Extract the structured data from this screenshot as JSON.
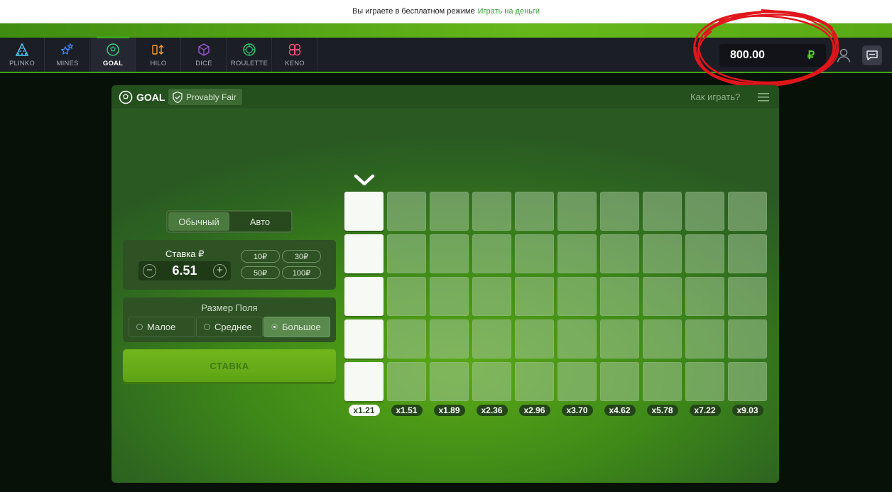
{
  "notice": {
    "text": "Вы играете в бесплатном режиме",
    "link": "Играть на деньги"
  },
  "nav": {
    "items": [
      {
        "label": "PLINKO",
        "icon": "plinko-icon",
        "color": "#4fd0ff"
      },
      {
        "label": "MINES",
        "icon": "mines-icon",
        "color": "#3f8cff"
      },
      {
        "label": "GOAL",
        "icon": "goal-icon",
        "color": "#39d07a",
        "active": true
      },
      {
        "label": "HILO",
        "icon": "hilo-icon",
        "color": "#ff9a2e"
      },
      {
        "label": "DICE",
        "icon": "dice-icon",
        "color": "#9b5bd6"
      },
      {
        "label": "ROULETTE",
        "icon": "roulette-icon",
        "color": "#2ec46e"
      },
      {
        "label": "KENO",
        "icon": "keno-icon",
        "color": "#ff4f7a"
      }
    ],
    "balance": "800.00",
    "currency": "₽"
  },
  "game": {
    "title": "GOAL",
    "provably_fair": "Provably Fair",
    "how_to": "Как играть?",
    "mode": {
      "manual": "Обычный",
      "auto": "Авто",
      "selected": "manual"
    },
    "bet": {
      "label": "Ставка ₽",
      "value": "6.51",
      "quick": [
        "10₽",
        "30₽",
        "50₽",
        "100₽"
      ]
    },
    "field_size": {
      "label": "Размер Поля",
      "options": [
        "Малое",
        "Среднее",
        "Большое"
      ],
      "selected": "Большое"
    },
    "bet_button": "СТАВКА",
    "rows": 5,
    "multipliers": [
      "x1.21",
      "x1.51",
      "x1.89",
      "x2.36",
      "x2.96",
      "x3.70",
      "x4.62",
      "x5.78",
      "x7.22",
      "x9.03"
    ],
    "active_column": 0
  }
}
